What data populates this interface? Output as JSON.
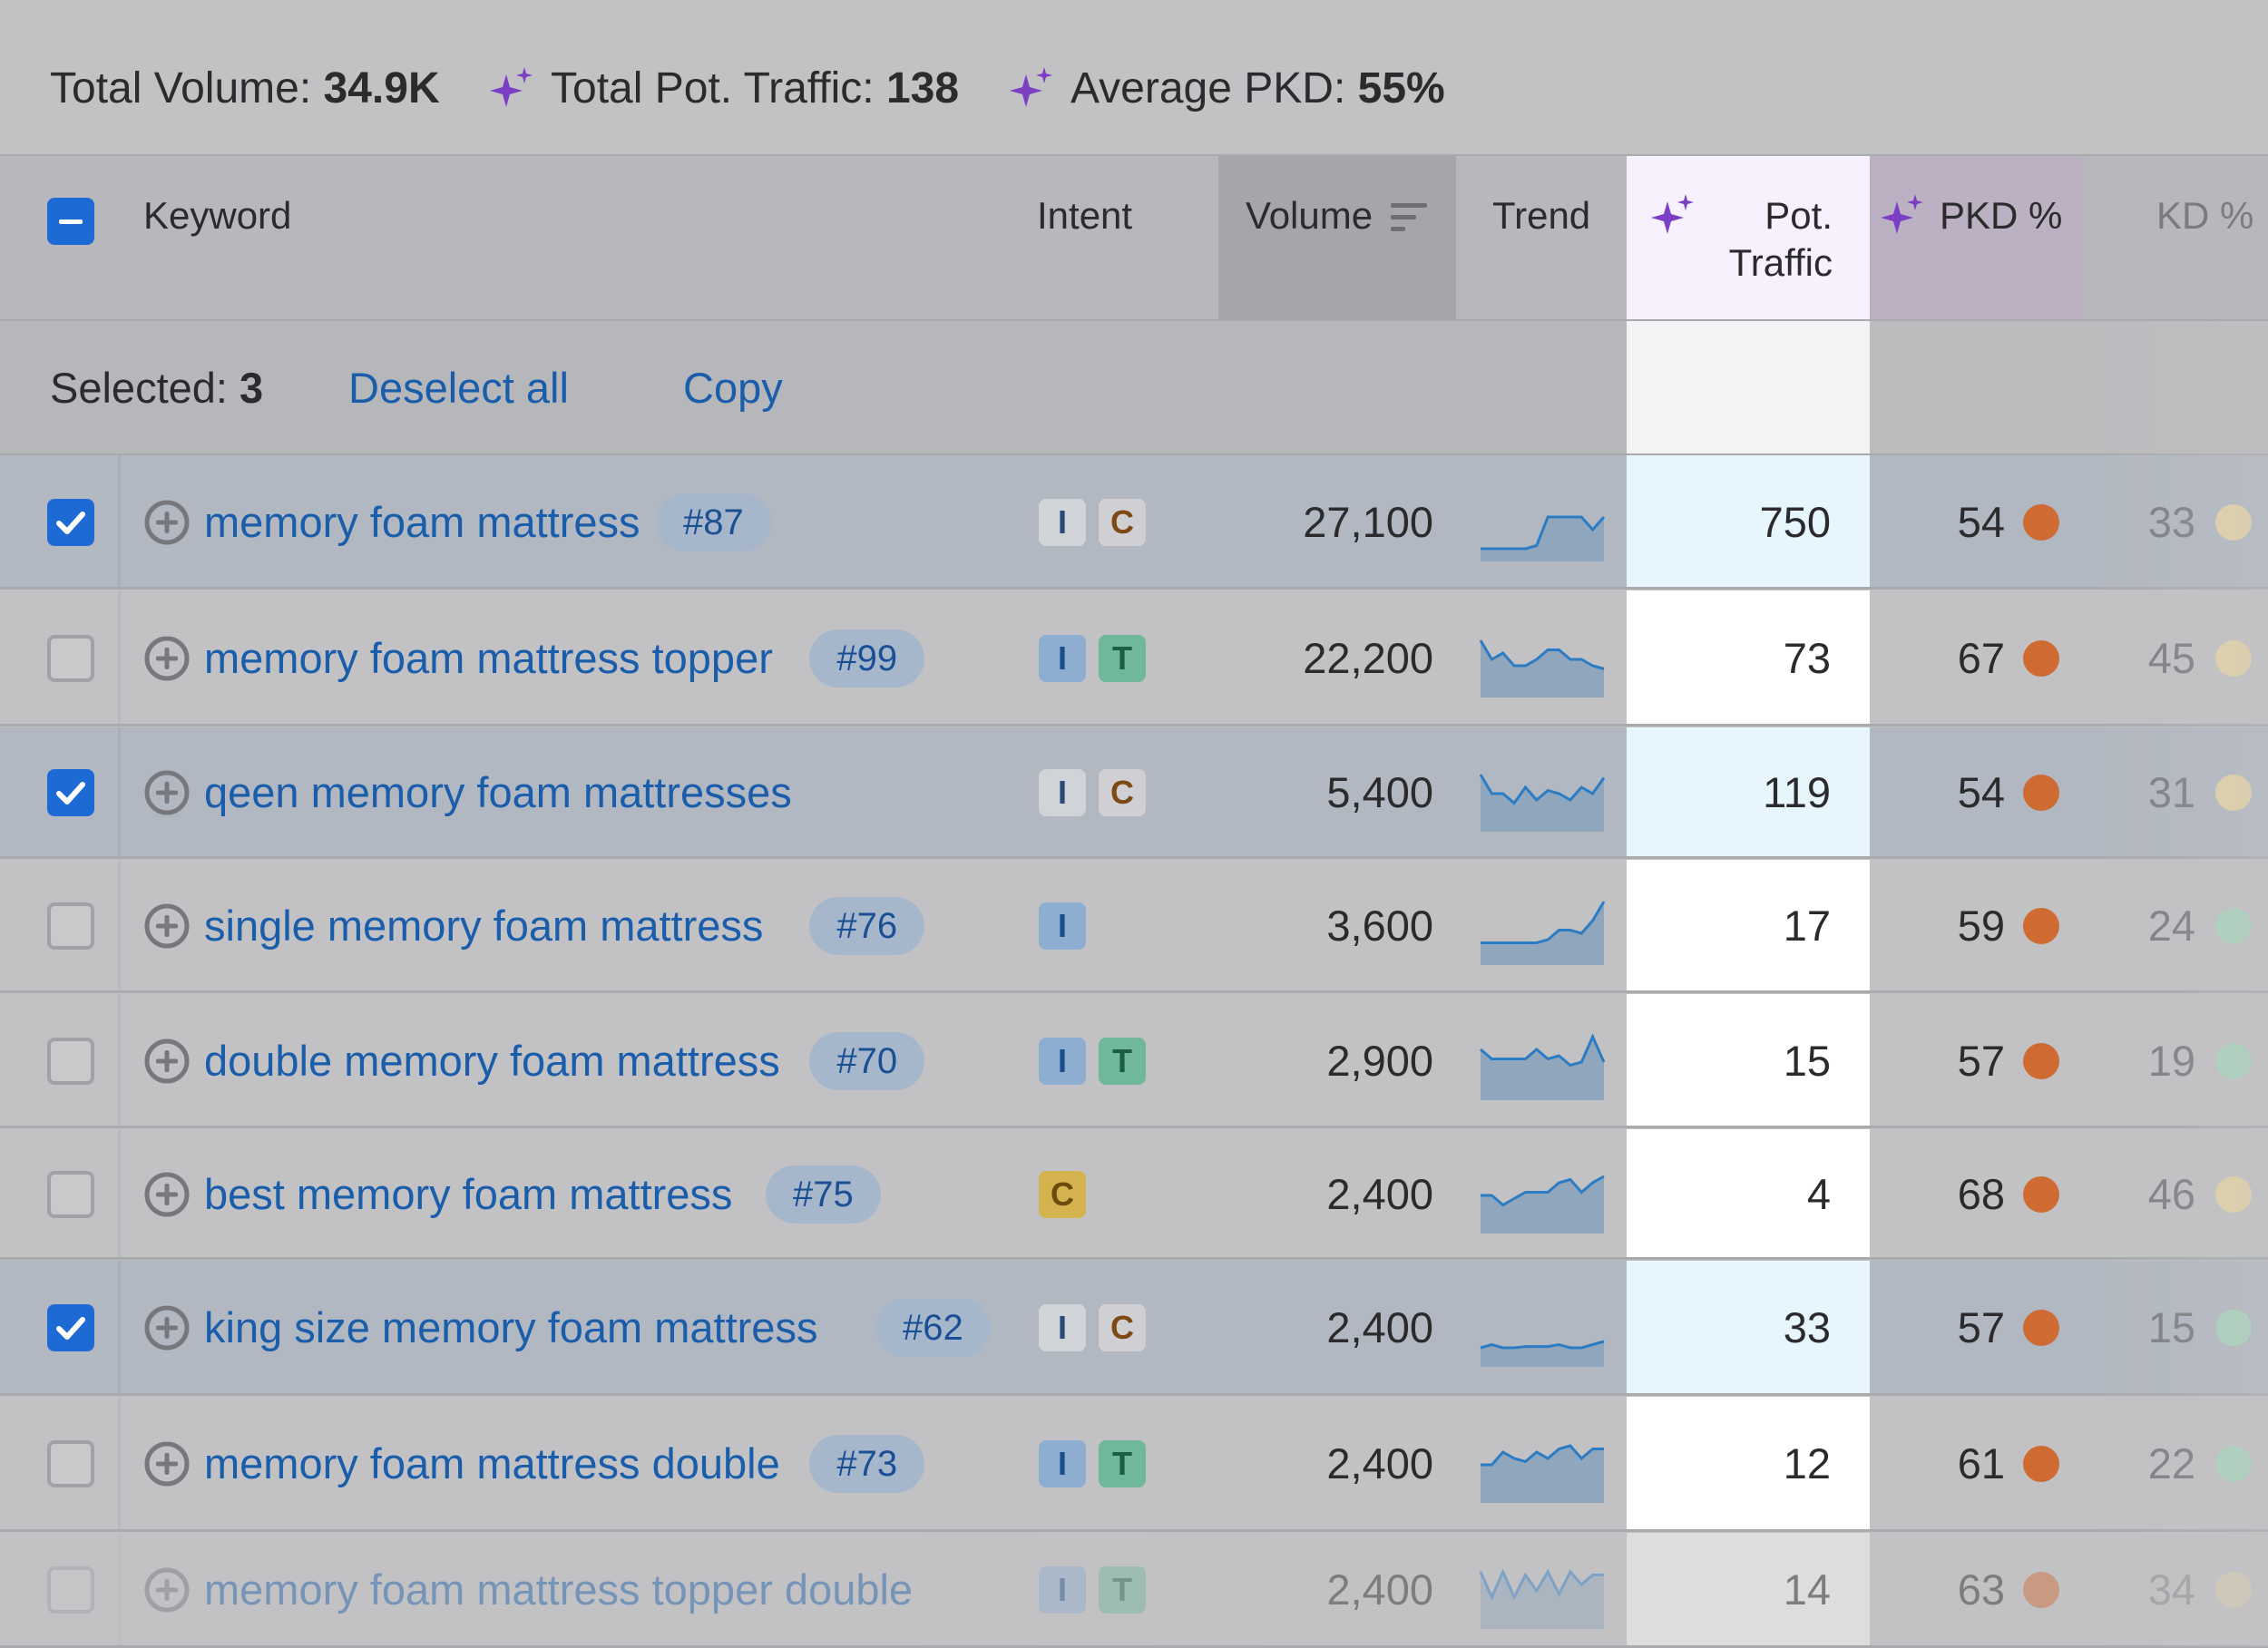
{
  "summary": {
    "total_volume_label": "Total Volume:",
    "total_volume_value": "34.9K",
    "pot_traffic_label": "Total Pot. Traffic:",
    "pot_traffic_value": "138",
    "avg_pkd_label": "Average PKD:",
    "avg_pkd_value": "55%"
  },
  "header": {
    "keyword": "Keyword",
    "intent": "Intent",
    "volume": "Volume",
    "trend": "Trend",
    "pot_traffic_line1": "Pot.",
    "pot_traffic_line2": "Traffic",
    "pkd": "PKD %",
    "kd": "KD %"
  },
  "selection": {
    "selected_label": "Selected:",
    "selected_count": "3",
    "deselect_all": "Deselect all",
    "copy": "Copy"
  },
  "colors": {
    "link": "#1a5dab",
    "checkbox_on": "#1d6ad4",
    "pkd_dot": "#cf6a32",
    "sparkle": "#7b3fc4"
  },
  "rows": [
    {
      "selected": true,
      "keyword": "memory foam mattress",
      "position": "#87",
      "intents": [
        "I",
        "C"
      ],
      "volume": "27,100",
      "trend": [
        0.2,
        0.2,
        0.2,
        0.2,
        0.2,
        0.25,
        0.7,
        0.7,
        0.7,
        0.7,
        0.5,
        0.7
      ],
      "pot_traffic": "750",
      "pkd": "54",
      "kd": "33",
      "kd_color": "#e6d4a6"
    },
    {
      "selected": false,
      "keyword": "memory foam mattress topper",
      "position": "#99",
      "intents": [
        "I",
        "T"
      ],
      "volume": "22,200",
      "trend": [
        0.9,
        0.6,
        0.7,
        0.5,
        0.5,
        0.6,
        0.75,
        0.75,
        0.6,
        0.6,
        0.5,
        0.45
      ],
      "pot_traffic": "73",
      "pkd": "67",
      "kd": "45",
      "kd_color": "#e6d4a6"
    },
    {
      "selected": true,
      "keyword": "qeen memory foam mattresses",
      "position": "",
      "intents": [
        "I",
        "C"
      ],
      "volume": "5,400",
      "trend": [
        0.9,
        0.6,
        0.6,
        0.45,
        0.7,
        0.5,
        0.65,
        0.6,
        0.5,
        0.7,
        0.6,
        0.85
      ],
      "pot_traffic": "119",
      "pkd": "54",
      "kd": "31",
      "kd_color": "#e6d4a6"
    },
    {
      "selected": false,
      "keyword": "single memory foam mattress",
      "position": "#76",
      "intents": [
        "I"
      ],
      "volume": "3,600",
      "trend": [
        0.35,
        0.35,
        0.35,
        0.35,
        0.35,
        0.35,
        0.4,
        0.55,
        0.55,
        0.5,
        0.7,
        1.0
      ],
      "pot_traffic": "17",
      "pkd": "59",
      "kd": "24",
      "kd_color": "#a9d4bd"
    },
    {
      "selected": false,
      "keyword": "double memory foam mattress",
      "position": "#70",
      "intents": [
        "I",
        "T"
      ],
      "volume": "2,900",
      "trend": [
        0.8,
        0.65,
        0.65,
        0.65,
        0.65,
        0.8,
        0.65,
        0.7,
        0.55,
        0.6,
        1.0,
        0.6
      ],
      "pot_traffic": "15",
      "pkd": "57",
      "kd": "19",
      "kd_color": "#a9d4bd"
    },
    {
      "selected": false,
      "keyword": "best memory foam mattress",
      "position": "#75",
      "intents": [
        "C"
      ],
      "volume": "2,400",
      "trend": [
        0.6,
        0.6,
        0.45,
        0.55,
        0.65,
        0.65,
        0.65,
        0.8,
        0.85,
        0.65,
        0.8,
        0.9
      ],
      "pot_traffic": "4",
      "pkd": "68",
      "kd": "46",
      "kd_color": "#e6d4a6"
    },
    {
      "selected": true,
      "keyword": "king size memory foam mattress",
      "position": "#62",
      "intents": [
        "I",
        "C"
      ],
      "volume": "2,400",
      "trend": [
        0.3,
        0.35,
        0.3,
        0.3,
        0.32,
        0.32,
        0.32,
        0.35,
        0.3,
        0.3,
        0.35,
        0.4
      ],
      "pot_traffic": "33",
      "pkd": "57",
      "kd": "15",
      "kd_color": "#a9d4bd"
    },
    {
      "selected": false,
      "keyword": "memory foam mattress double",
      "position": "#73",
      "intents": [
        "I",
        "T"
      ],
      "volume": "2,400",
      "trend": [
        0.6,
        0.6,
        0.8,
        0.7,
        0.65,
        0.8,
        0.7,
        0.85,
        0.9,
        0.7,
        0.85,
        0.85
      ],
      "pot_traffic": "12",
      "pkd": "61",
      "kd": "22",
      "kd_color": "#a9d4bd"
    },
    {
      "selected": false,
      "keyword": "memory foam mattress topper double",
      "position": "",
      "intents": [
        "I",
        "T"
      ],
      "volume": "2,400",
      "trend": [
        0.9,
        0.5,
        0.9,
        0.5,
        0.85,
        0.6,
        0.9,
        0.55,
        0.9,
        0.7,
        0.85,
        0.85
      ],
      "pot_traffic": "14",
      "pkd": "63",
      "kd": "34",
      "kd_color": "#e6d4a6"
    }
  ]
}
